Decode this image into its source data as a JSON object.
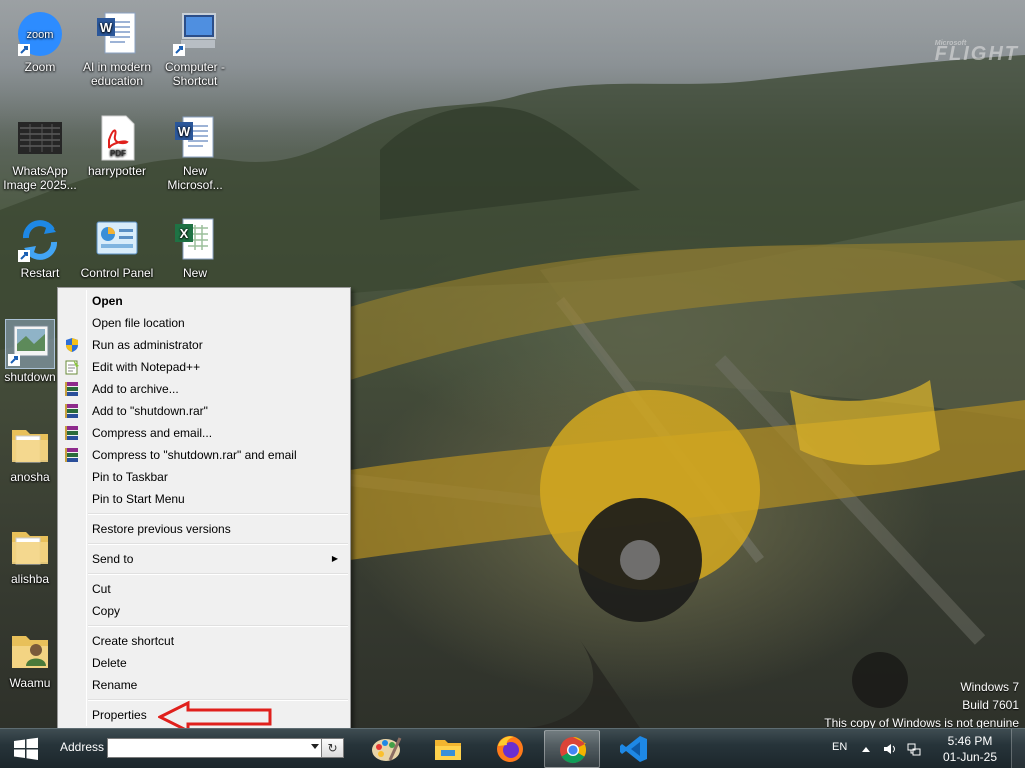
{
  "desktop": {
    "icons": [
      {
        "label": "Zoom",
        "icon": "zoom-icon"
      },
      {
        "label": "AI in modern education",
        "icon": "word-doc-icon"
      },
      {
        "label": "Computer - Shortcut",
        "icon": "computer-icon"
      },
      {
        "label": "WhatsApp Image 2025...",
        "icon": "image-file-icon"
      },
      {
        "label": "harrypotter",
        "icon": "pdf-icon"
      },
      {
        "label": "New Microsof...",
        "icon": "word-doc-icon"
      },
      {
        "label": "Restart",
        "icon": "restart-icon"
      },
      {
        "label": "Control Panel",
        "icon": "control-panel-icon"
      },
      {
        "label": "New Microsof...",
        "icon": "excel-doc-icon"
      },
      {
        "label": "shutdown",
        "icon": "shortcut-icon"
      },
      {
        "label": "anosha",
        "icon": "folder-icon"
      },
      {
        "label": "alishba",
        "icon": "folder-icon"
      },
      {
        "label": "Waamu",
        "icon": "user-folder-icon"
      }
    ],
    "logo_text": "FLIGHT",
    "logo_small": "Microsoft"
  },
  "context_menu": {
    "items": [
      {
        "label": "Open",
        "bold": true
      },
      {
        "label": "Open file location"
      },
      {
        "label": "Run as administrator",
        "icon": "shield-icon"
      },
      {
        "label": "Edit with Notepad++",
        "icon": "notepad-plus-icon"
      },
      {
        "label": "Add to archive...",
        "icon": "winrar-icon"
      },
      {
        "label": "Add to \"shutdown.rar\"",
        "icon": "winrar-icon"
      },
      {
        "label": "Compress and email...",
        "icon": "winrar-icon"
      },
      {
        "label": "Compress to \"shutdown.rar\" and email",
        "icon": "winrar-icon"
      },
      {
        "label": "Pin to Taskbar"
      },
      {
        "label": "Pin to Start Menu"
      },
      {
        "label": "Restore previous versions"
      },
      {
        "label": "Send to"
      },
      {
        "label": "Cut"
      },
      {
        "label": "Copy"
      },
      {
        "label": "Create shortcut"
      },
      {
        "label": "Delete"
      },
      {
        "label": "Rename"
      },
      {
        "label": "Properties"
      }
    ]
  },
  "watermark": {
    "line1": "Windows 7",
    "line2": "Build 7601",
    "line3": "This copy of Windows is not genuine"
  },
  "taskbar": {
    "address_label": "Address",
    "address_value": "",
    "refresh_glyph": "↻",
    "apps": [
      "paint-icon",
      "file-explorer-icon",
      "firefox-icon",
      "chrome-icon",
      "vscode-icon"
    ],
    "language": "EN",
    "time": "5:46 PM",
    "date": "01-Jun-25"
  },
  "colors": {
    "taskbar": "#1c262b",
    "menu_bg": "#f0f0f0",
    "arrow_red": "#e0201c"
  }
}
